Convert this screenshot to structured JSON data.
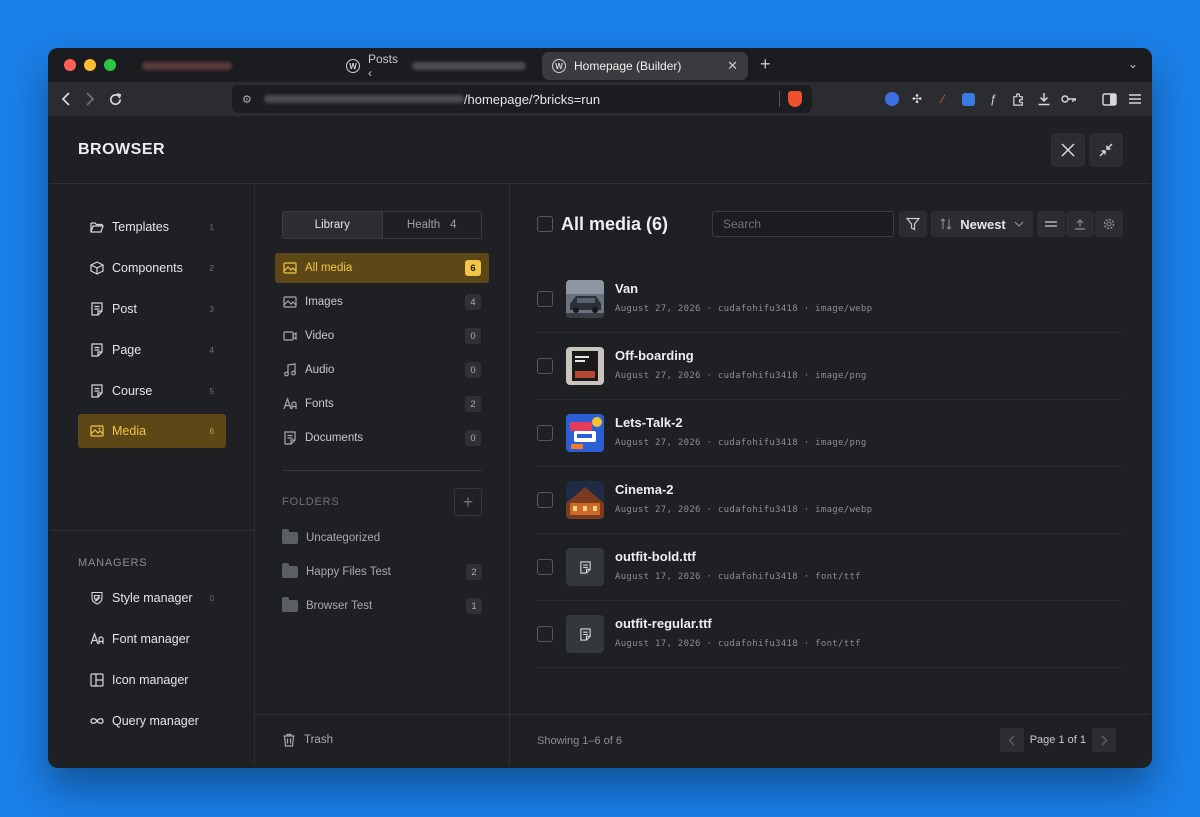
{
  "browser": {
    "tabs": [
      {
        "label": "",
        "blurred": true
      },
      {
        "label": "Posts ‹",
        "blurred_suffix": true
      },
      {
        "label": "Homepage (Builder)",
        "active": true
      }
    ],
    "url_path": "/homepage/?bricks=run"
  },
  "app": {
    "title": "BROWSER"
  },
  "leftnav": {
    "items": [
      {
        "label": "Templates",
        "count": "1",
        "icon": "folder-open-icon"
      },
      {
        "label": "Components",
        "count": "2",
        "icon": "cube-icon"
      },
      {
        "label": "Post",
        "count": "3",
        "icon": "document-icon"
      },
      {
        "label": "Page",
        "count": "4",
        "icon": "document-icon"
      },
      {
        "label": "Course",
        "count": "5",
        "icon": "document-icon"
      },
      {
        "label": "Media",
        "count": "6",
        "icon": "image-icon",
        "active": true
      }
    ],
    "managers_label": "MANAGERS",
    "managers": [
      {
        "label": "Style manager",
        "count": "0",
        "icon": "shield-icon"
      },
      {
        "label": "Font manager",
        "icon": "font-icon"
      },
      {
        "label": "Icon manager",
        "icon": "layout-icon"
      },
      {
        "label": "Query manager",
        "icon": "infinity-icon"
      }
    ]
  },
  "middle": {
    "tabs": [
      {
        "label": "Library",
        "active": true
      },
      {
        "label": "Health",
        "count": "4"
      }
    ],
    "categories": [
      {
        "label": "All media",
        "count": "6",
        "icon": "image-icon",
        "active": true
      },
      {
        "label": "Images",
        "count": "4",
        "icon": "image-icon"
      },
      {
        "label": "Video",
        "count": "0",
        "icon": "video-icon"
      },
      {
        "label": "Audio",
        "count": "0",
        "icon": "music-icon"
      },
      {
        "label": "Fonts",
        "count": "2",
        "icon": "font-icon"
      },
      {
        "label": "Documents",
        "count": "0",
        "icon": "document-icon"
      }
    ],
    "folders_label": "FOLDERS",
    "folders": [
      {
        "label": "Uncategorized",
        "count": ""
      },
      {
        "label": "Happy Files Test",
        "count": "2"
      },
      {
        "label": "Browser Test",
        "count": "1"
      }
    ],
    "trash_label": "Trash"
  },
  "main": {
    "title": "All media (6)",
    "search_placeholder": "Search",
    "sort_label": "Newest",
    "items": [
      {
        "name": "Van",
        "meta": "August 27, 2026 · cudafohifu3418 · image/webp",
        "thumb": "van"
      },
      {
        "name": "Off-boarding",
        "meta": "August 27, 2026 · cudafohifu3418 · image/png",
        "thumb": "offboarding"
      },
      {
        "name": "Lets-Talk-2",
        "meta": "August 27, 2026 · cudafohifu3418 · image/png",
        "thumb": "letstalk"
      },
      {
        "name": "Cinema-2",
        "meta": "August 27, 2026 · cudafohifu3418 · image/webp",
        "thumb": "cinema"
      },
      {
        "name": "outfit-bold.ttf",
        "meta": "August 17, 2026 · cudafohifu3418 · font/ttf",
        "thumb": "font"
      },
      {
        "name": "outfit-regular.ttf",
        "meta": "August 17, 2026 · cudafohifu3418 · font/ttf",
        "thumb": "font"
      }
    ],
    "showing": "Showing 1–6 of 6",
    "page_label": "Page 1 of 1"
  },
  "colors": {
    "accent": "#f3c64a",
    "accent_bg": "#5d4716",
    "desktop": "#1a7fe8"
  }
}
